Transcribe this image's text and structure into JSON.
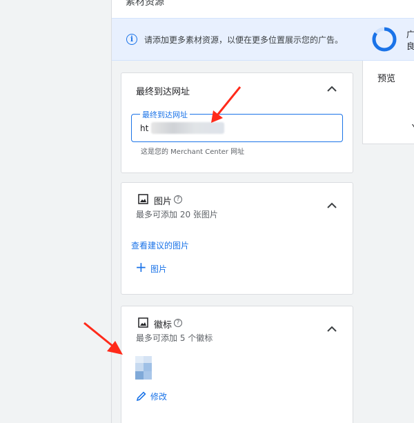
{
  "header": {
    "title": "素材资源"
  },
  "banner": {
    "info_icon": "info-icon",
    "text": "请添加更多素材资源，以便在更多位置展示您的广告。",
    "strength_label_1": "广",
    "strength_label_2": "良"
  },
  "url_card": {
    "title": "最终到达网址",
    "field_label": "最终到达网址",
    "value_prefix": "ht",
    "helper": "这是您的 Merchant Center 网址"
  },
  "images_card": {
    "title": "图片",
    "subtitle": "最多可添加 20 张图片",
    "suggest_link": "查看建议的图片",
    "add_label": "图片"
  },
  "logo_card": {
    "title": "徽标",
    "subtitle": "最多可添加 5 个徽标",
    "edit_label": "修改"
  },
  "preview": {
    "title": "预览",
    "partial_letter": "Y"
  },
  "colors": {
    "accent": "#1a73e8",
    "annotation_arrow": "#ff2a1a",
    "banner_bg": "#e8f0fe"
  }
}
